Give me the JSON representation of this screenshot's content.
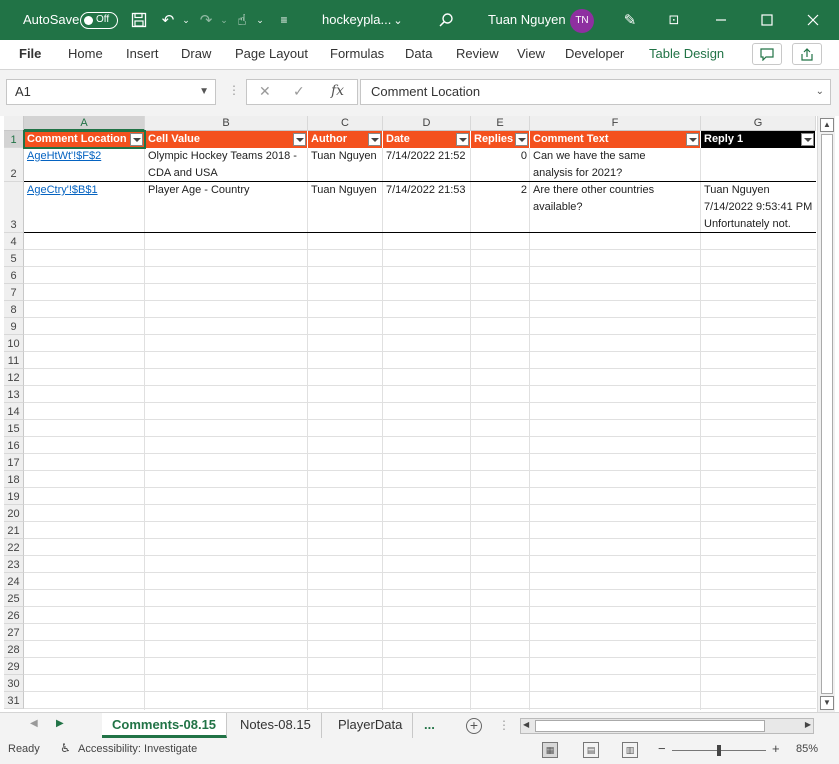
{
  "title": {
    "autosave_label": "AutoSave",
    "autosave_state": "Off",
    "filename": "hockeypla...",
    "user_name": "Tuan Nguyen",
    "user_initials": "TN"
  },
  "ribbon_tabs": [
    "File",
    "Home",
    "Insert",
    "Draw",
    "Page Layout",
    "Formulas",
    "Data",
    "Review",
    "View",
    "Developer",
    "Table Design"
  ],
  "formula_bar": {
    "name_box": "A1",
    "fx": "fx",
    "content": "Comment Location"
  },
  "columns": [
    "A",
    "B",
    "C",
    "D",
    "E",
    "F",
    "G"
  ],
  "rows": [
    "1",
    "2",
    "3",
    "4",
    "5",
    "6",
    "7",
    "8",
    "9",
    "10",
    "11",
    "12",
    "13",
    "14",
    "15",
    "16",
    "17",
    "18",
    "19",
    "20",
    "21",
    "22",
    "23",
    "24",
    "25",
    "26",
    "27",
    "28",
    "29",
    "30",
    "31"
  ],
  "table": {
    "headers": [
      "Comment Location",
      "Cell Value",
      "Author",
      "Date",
      "Replies",
      "Comment Text",
      "Reply 1"
    ],
    "data": [
      {
        "location": "AgeHtWt'!$F$2",
        "value_l1": "Olympic Hockey Teams 2018 -",
        "value_l2": "CDA and USA",
        "author": "Tuan Nguyen",
        "date": "7/14/2022 21:52",
        "replies": "0",
        "text_l1": "Can we have the same",
        "text_l2": "analysis for 2021?",
        "reply_l1": "",
        "reply_l2": "",
        "reply_l3": ""
      },
      {
        "location": "AgeCtry'!$B$1",
        "value_l1": "Player Age - Country",
        "value_l2": "",
        "author": "Tuan Nguyen",
        "date": "7/14/2022 21:53",
        "replies": "2",
        "text_l1": "Are there other countries",
        "text_l2": "available?",
        "reply_l1": "Tuan Nguyen",
        "reply_l2": "7/14/2022 9:53:41 PM",
        "reply_l3": "Unfortunately not."
      }
    ]
  },
  "sheets": {
    "tabs": [
      "Comments-08.15",
      "Notes-08.15",
      "PlayerData"
    ],
    "overflow": "...",
    "active_index": 0
  },
  "status": {
    "ready": "Ready",
    "accessibility": "Accessibility: Investigate",
    "zoom": "85%",
    "zoom_fraction": 0.5
  },
  "colors": {
    "excel_green": "#217346",
    "header_orange": "#f4511e",
    "header_black": "#000000",
    "link_blue": "#0563c1",
    "avatar_purple": "#8e2fa0"
  }
}
